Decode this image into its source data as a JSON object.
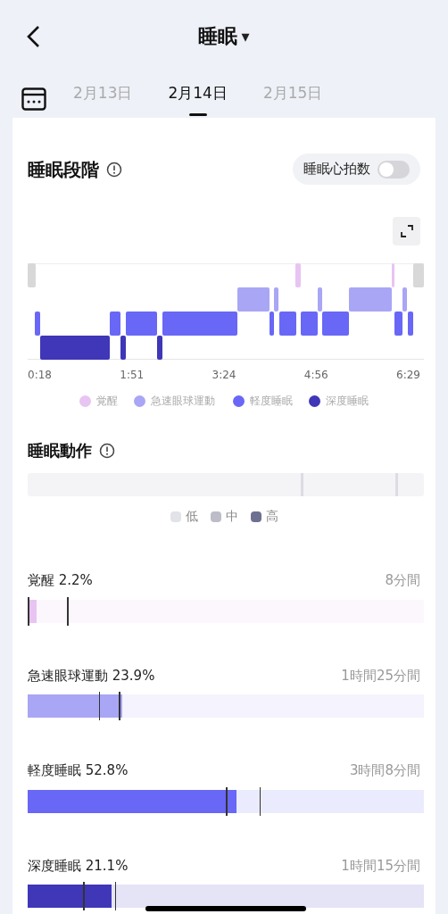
{
  "header": {
    "title": "睡眠",
    "dropdown_caret": "▾"
  },
  "date_tabs": [
    {
      "label": "2月13日",
      "selected": false
    },
    {
      "label": "2月14日",
      "selected": true
    },
    {
      "label": "2月15日",
      "selected": false
    }
  ],
  "sleep_stages": {
    "title": "睡眠段階",
    "heart_rate_toggle": {
      "label": "睡眠心拍数",
      "on": false
    },
    "x_labels": [
      "0:18",
      "1:51",
      "3:24",
      "4:56",
      "6:29"
    ],
    "legend": [
      {
        "label": "覚醒",
        "color": "#e8c4f2"
      },
      {
        "label": "急速眼球運動",
        "color": "#a9a6f5"
      },
      {
        "label": "軽度睡眠",
        "color": "#6967f6"
      },
      {
        "label": "深度睡眠",
        "color": "#3f36b8"
      }
    ]
  },
  "sleep_motion": {
    "title": "睡眠動作",
    "legend": [
      {
        "label": "低",
        "color": "#e2e3e8"
      },
      {
        "label": "中",
        "color": "#bcbdc8"
      },
      {
        "label": "高",
        "color": "#6d7091"
      }
    ]
  },
  "stats": [
    {
      "label": "覚醒 2.2%",
      "duration": "8分間",
      "level": 0.022,
      "color": "#e8c4f2"
    },
    {
      "label": "急速眼球運動 23.9%",
      "duration": "1時間25分間",
      "level": 0.239,
      "color": "#a9a6f5"
    },
    {
      "label": "軽度睡眠 52.8%",
      "duration": "3時間8分間",
      "level": 0.528,
      "color": "#6967f6"
    },
    {
      "label": "深度睡眠 21.1%",
      "duration": "1時間15分間",
      "level": 0.211,
      "color": "#3f36b8"
    }
  ]
}
